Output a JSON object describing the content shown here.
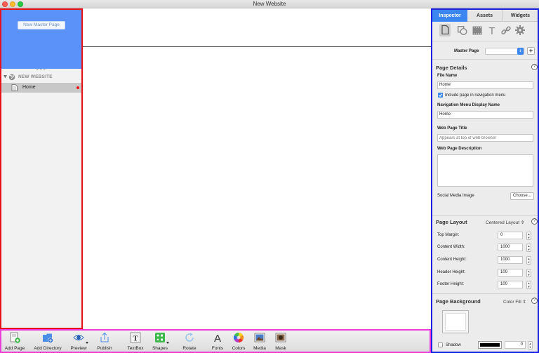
{
  "window": {
    "title": "New Website"
  },
  "sidebar": {
    "new_master_page_label": "New Master Page",
    "site_name": "NEW WEBSITE",
    "pages": [
      {
        "label": "Home",
        "unsaved": true
      }
    ]
  },
  "toolbar": {
    "items": [
      {
        "label": "Add Page",
        "icon": "add-page-icon"
      },
      {
        "label": "Add Directory",
        "icon": "add-directory-icon"
      },
      {
        "label": "Preview",
        "icon": "eye-icon"
      },
      {
        "label": "Publish",
        "icon": "publish-icon"
      },
      {
        "label": "TextBox",
        "icon": "textbox-icon"
      },
      {
        "label": "Shapes",
        "icon": "shapes-icon"
      },
      {
        "label": "Rotate",
        "icon": "rotate-icon"
      },
      {
        "label": "Fonts",
        "icon": "fonts-icon"
      },
      {
        "label": "Colors",
        "icon": "color-wheel-icon"
      },
      {
        "label": "Media",
        "icon": "media-icon"
      },
      {
        "label": "Mask",
        "icon": "mask-icon"
      }
    ]
  },
  "inspector": {
    "tabs": [
      {
        "label": "Inspector",
        "active": true
      },
      {
        "label": "Assets",
        "active": false
      },
      {
        "label": "Widgets",
        "active": false
      }
    ],
    "master_page_label": "Master Page",
    "master_page_value": "",
    "page_details": {
      "title": "Page Details",
      "file_name_label": "File Name",
      "file_name_value": "Home",
      "include_nav_label": "Include page in navigation menu",
      "include_nav_checked": true,
      "nav_display_label": "Navigation Menu Display Name",
      "nav_display_value": "Home",
      "web_title_label": "Web Page Title",
      "web_title_placeholder": "Appears at top of web browser",
      "web_desc_label": "Web Page Description",
      "social_image_label": "Social Media Image",
      "choose_label": "Choose..."
    },
    "page_layout": {
      "title": "Page Layout",
      "layout_value": "Centered Layout",
      "rows": [
        {
          "label": "Top Margin:",
          "value": "0"
        },
        {
          "label": "Content Width:",
          "value": "1000"
        },
        {
          "label": "Content Height:",
          "value": "1000"
        },
        {
          "label": "Header Height:",
          "value": "100"
        },
        {
          "label": "Footer Height:",
          "value": "100"
        }
      ]
    },
    "page_background": {
      "title": "Page Background",
      "fill_value": "Color Fill",
      "shadow_label": "Shadow",
      "shadow_value": "0"
    }
  },
  "colors": {
    "sidebar_border": "#e8111a",
    "toolbar_border": "#ee3bdc",
    "inspector_border": "#1b22e0",
    "master_area": "#5b92fa",
    "active_tab": "#3c86f1"
  }
}
